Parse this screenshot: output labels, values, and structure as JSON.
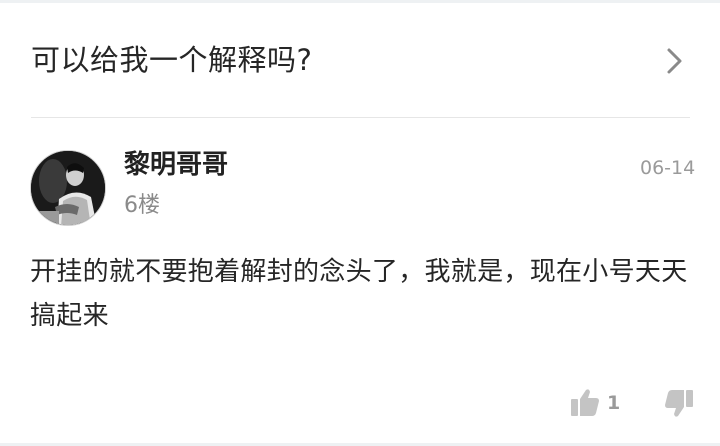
{
  "question": {
    "title": "可以给我一个解释吗?"
  },
  "reply": {
    "username": "黎明哥哥",
    "floor": "6楼",
    "date": "06-14",
    "content": "开挂的就不要抱着解封的念头了，我就是，现在小号天天搞起来",
    "likes": "1"
  },
  "icons": {
    "chevron": "chevron-right-icon",
    "like": "thumbs-up-icon",
    "dislike": "thumbs-down-icon"
  },
  "colors": {
    "text": "#262626",
    "muted": "#9a9a9a",
    "divider": "#e6e6e6"
  }
}
